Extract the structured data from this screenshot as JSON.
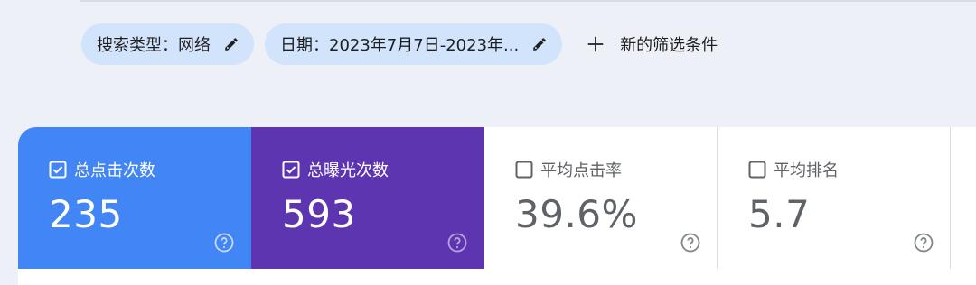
{
  "filters": {
    "chips": [
      {
        "label": "搜索类型：网络",
        "icon": "pencil-icon"
      },
      {
        "label": "日期：2023年7月7日-2023年...",
        "icon": "pencil-icon"
      }
    ],
    "add_filter_label": "新的筛选条件"
  },
  "metrics": [
    {
      "title": "总点击次数",
      "value": "235",
      "checked": true,
      "color": "#4285f4"
    },
    {
      "title": "总曝光次数",
      "value": "593",
      "checked": true,
      "color": "#5e35b1"
    },
    {
      "title": "平均点击率",
      "value": "39.6%",
      "checked": false,
      "color": "#ffffff"
    },
    {
      "title": "平均排名",
      "value": "5.7",
      "checked": false,
      "color": "#ffffff"
    }
  ]
}
